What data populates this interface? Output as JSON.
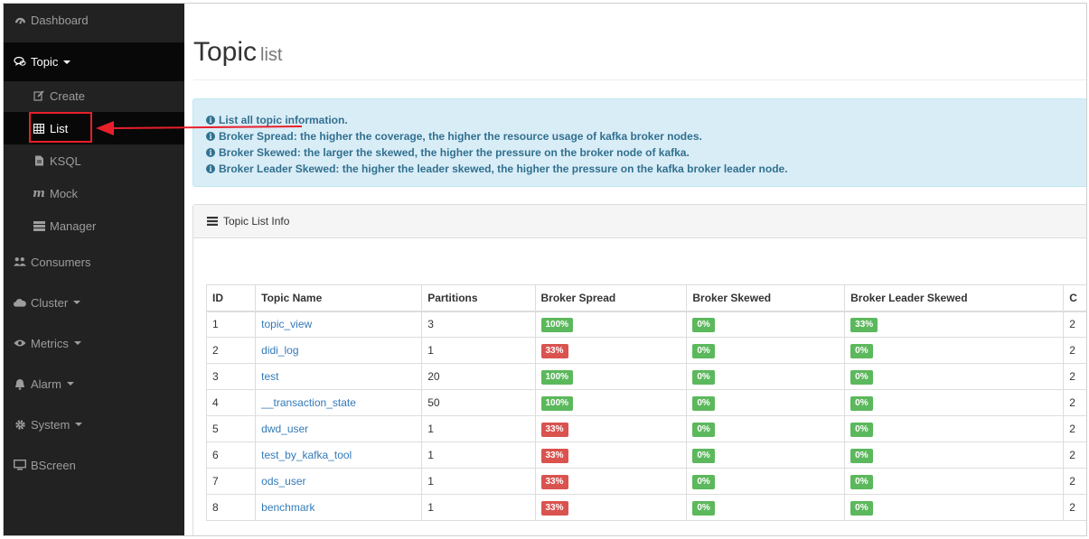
{
  "sidebar": {
    "items": [
      {
        "label": "Dashboard",
        "icon": "dashboard-icon"
      },
      {
        "label": "Topic",
        "icon": "topic-icon",
        "active": true,
        "expanded": true
      },
      {
        "label": "Create",
        "icon": "edit-icon",
        "sub": true
      },
      {
        "label": "List",
        "icon": "table-icon",
        "sub": true,
        "highlighted": true
      },
      {
        "label": "KSQL",
        "icon": "file-icon",
        "sub": true
      },
      {
        "label": "Mock",
        "icon": "mock-icon",
        "sub": true
      },
      {
        "label": "Manager",
        "icon": "manager-icon",
        "sub": true
      },
      {
        "label": "Consumers",
        "icon": "users-icon"
      },
      {
        "label": "Cluster",
        "icon": "cloud-icon",
        "caret": true
      },
      {
        "label": "Metrics",
        "icon": "eye-icon",
        "caret": true
      },
      {
        "label": "Alarm",
        "icon": "bell-icon",
        "caret": true
      },
      {
        "label": "System",
        "icon": "gear-icon",
        "caret": true
      },
      {
        "label": "BScreen",
        "icon": "monitor-icon"
      }
    ]
  },
  "header": {
    "title": "Topic",
    "subtitle": "list"
  },
  "alert": {
    "lines": [
      "List all topic information.",
      "Broker Spread: the higher the coverage, the higher the resource usage of kafka broker nodes.",
      "Broker Skewed: the larger the skewed, the higher the pressure on the broker node of kafka.",
      "Broker Leader Skewed: the higher the leader skewed, the higher the pressure on the kafka broker leader node."
    ]
  },
  "panel": {
    "title": "Topic List Info"
  },
  "table": {
    "columns": [
      "ID",
      "Topic Name",
      "Partitions",
      "Broker Spread",
      "Broker Skewed",
      "Broker Leader Skewed",
      "C"
    ],
    "rows": [
      {
        "id": "1",
        "name": "topic_view",
        "partitions": "3",
        "spread": "100%",
        "skewed": "0%",
        "leader": "33%",
        "c": "2"
      },
      {
        "id": "2",
        "name": "didi_log",
        "partitions": "1",
        "spread": "33%",
        "skewed": "0%",
        "leader": "0%",
        "c": "2"
      },
      {
        "id": "3",
        "name": "test",
        "partitions": "20",
        "spread": "100%",
        "skewed": "0%",
        "leader": "0%",
        "c": "2"
      },
      {
        "id": "4",
        "name": "__transaction_state",
        "partitions": "50",
        "spread": "100%",
        "skewed": "0%",
        "leader": "0%",
        "c": "2"
      },
      {
        "id": "5",
        "name": "dwd_user",
        "partitions": "1",
        "spread": "33%",
        "skewed": "0%",
        "leader": "0%",
        "c": "2"
      },
      {
        "id": "6",
        "name": "test_by_kafka_tool",
        "partitions": "1",
        "spread": "33%",
        "skewed": "0%",
        "leader": "0%",
        "c": "2"
      },
      {
        "id": "7",
        "name": "ods_user",
        "partitions": "1",
        "spread": "33%",
        "skewed": "0%",
        "leader": "0%",
        "c": "2"
      },
      {
        "id": "8",
        "name": "benchmark",
        "partitions": "1",
        "spread": "33%",
        "skewed": "0%",
        "leader": "0%",
        "c": "2"
      }
    ]
  },
  "colors": {
    "sidebar_bg": "#222222",
    "active_bg": "#080808",
    "highlight": "#e8202a",
    "success": "#5cb85c",
    "danger": "#d9534f",
    "link": "#337ab7"
  }
}
